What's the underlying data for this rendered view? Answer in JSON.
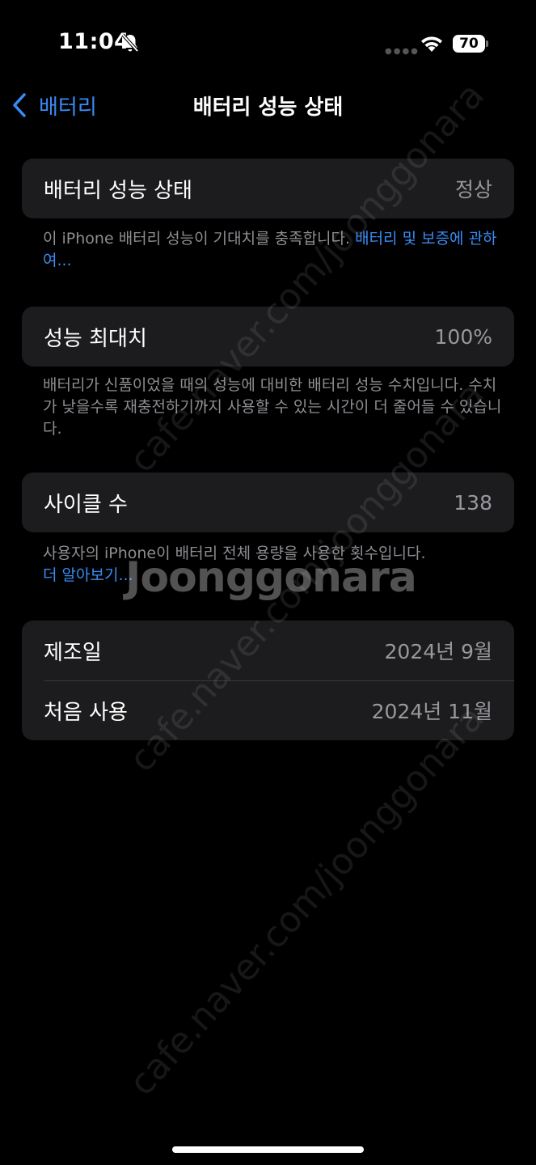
{
  "status": {
    "time": "11:04",
    "battery_percent": "70"
  },
  "nav": {
    "back_label": "배터리",
    "title": "배터리 성능 상태"
  },
  "health": {
    "label": "배터리 성능 상태",
    "value": "정상",
    "footnote": "이 iPhone 배터리 성능이 기대치를 충족합니다. ",
    "footnote_link": "배터리 및 보증에 관하여..."
  },
  "max_capacity": {
    "label": "성능 최대치",
    "value": "100%",
    "footnote": "배터리가 신품이었을 때의 성능에 대비한 배터리 성능 수치입니다. 수치가 낮을수록 재충전하기까지 사용할 수 있는 시간이 더 줄어들 수 있습니다."
  },
  "cycle": {
    "label": "사이클 수",
    "value": "138",
    "footnote": "사용자의 iPhone이 배터리 전체 용량을 사용한 횟수입니다.",
    "footnote_link": "더 알아보기..."
  },
  "dates": {
    "manufacture_label": "제조일",
    "manufacture_value": "2024년 9월",
    "first_use_label": "처음 사용",
    "first_use_value": "2024년 11월"
  },
  "watermark": {
    "text": "cafe.naver.com/joonggonara",
    "logo": "Joonggonara"
  },
  "colors": {
    "accent": "#3a8bf6",
    "background": "#000000",
    "group": "#1c1c1e",
    "secondary_text": "#98989d"
  }
}
